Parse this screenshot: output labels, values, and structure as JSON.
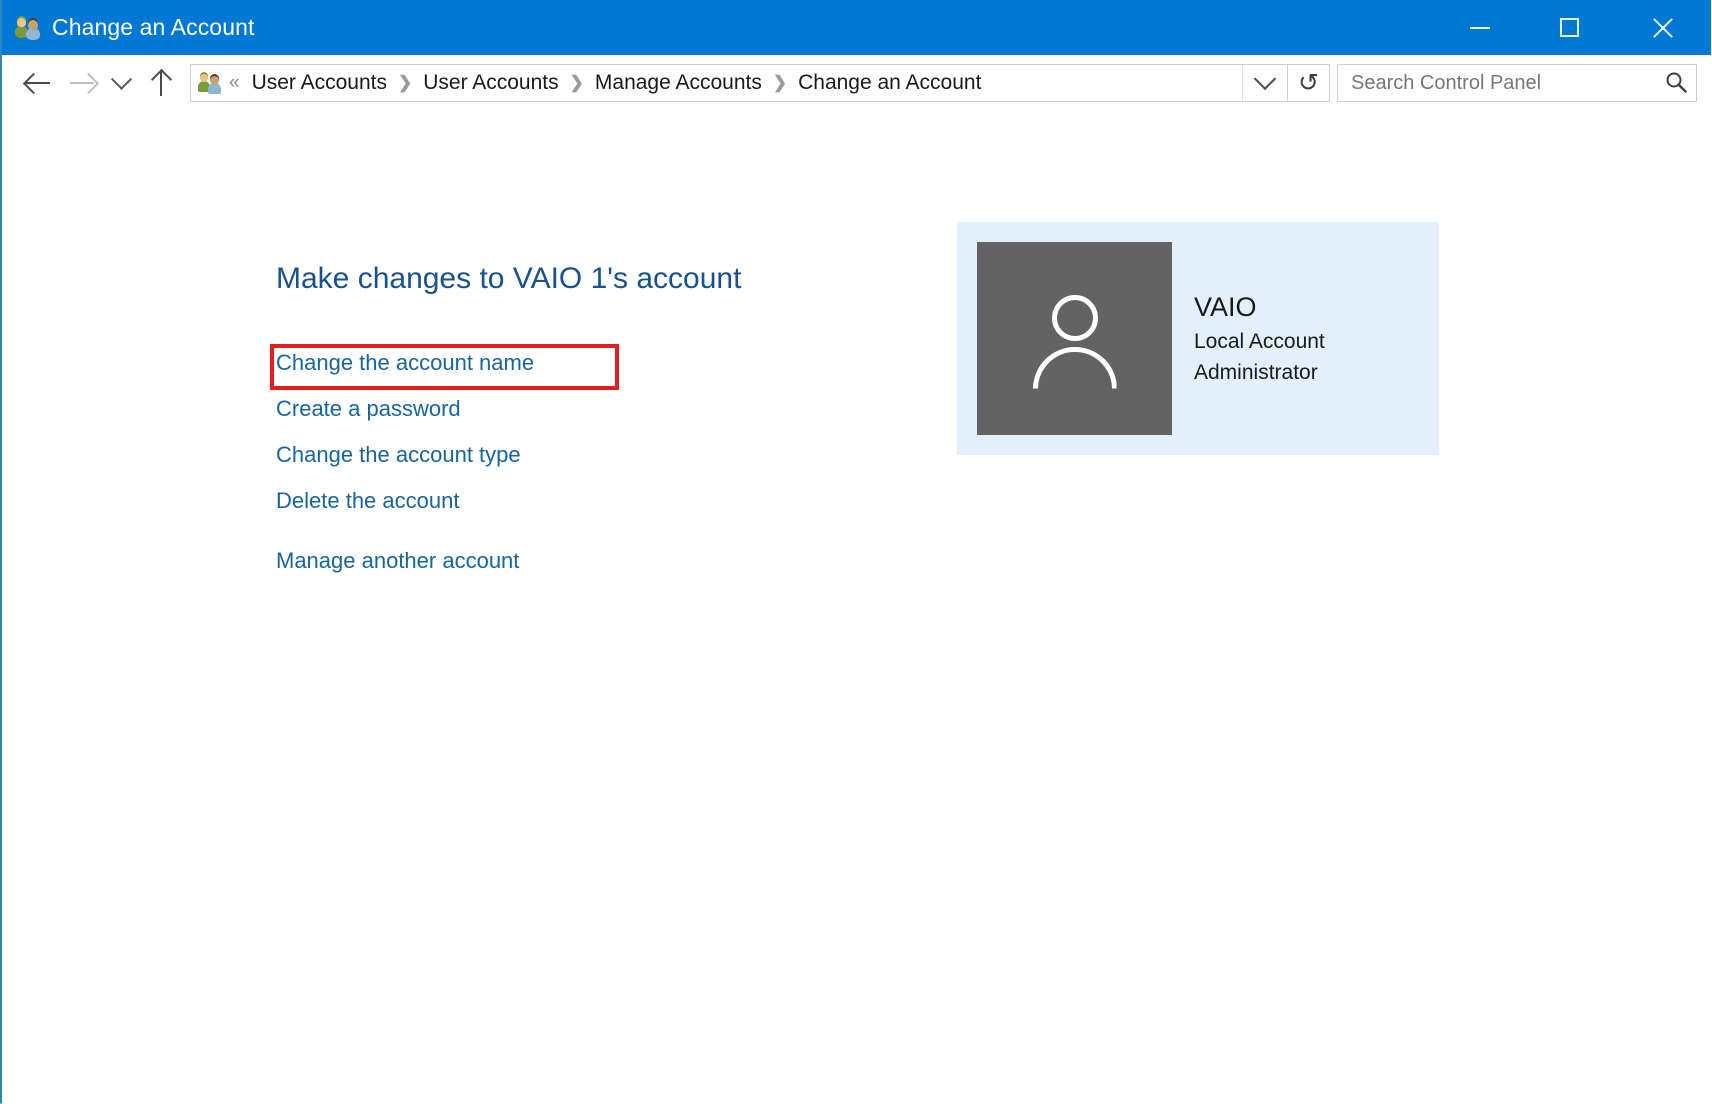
{
  "window": {
    "title": "Change an Account",
    "title_icon": "user-accounts-icon",
    "accent_color": "#0078d4",
    "caption": {
      "minimize_label": "Minimize",
      "maximize_label": "Maximize",
      "close_label": "Close"
    }
  },
  "navbar": {
    "back_label": "Back",
    "forward_label": "Forward",
    "recent_label": "Recent locations",
    "up_label": "Up one level",
    "address_icon": "user-accounts-icon",
    "overflow_glyph": "«",
    "breadcrumbs": [
      "User Accounts",
      "User Accounts",
      "Manage Accounts",
      "Change an Account"
    ],
    "breadcrumb_separator": "❯",
    "dropdown_label": "Previous locations",
    "refresh_glyph": "↻",
    "refresh_label": "Refresh"
  },
  "search": {
    "placeholder": "Search Control Panel",
    "value": "",
    "icon": "search-icon"
  },
  "main": {
    "page_title": "Make changes to VAIO 1's account",
    "task_links": [
      "Change the account name",
      "Create a password",
      "Change the account type",
      "Delete the account"
    ],
    "secondary_link": "Manage another account",
    "highlight": {
      "target": "Change the account name",
      "color": "#e02020"
    },
    "link_color": "#17649f",
    "title_color": "#17518f"
  },
  "account_panel": {
    "background_color": "#e3f0fb",
    "avatar_icon": "user-avatar-icon",
    "avatar_background": "#636363",
    "name": "VAIO",
    "account_type": "Local Account",
    "role": "Administrator"
  }
}
